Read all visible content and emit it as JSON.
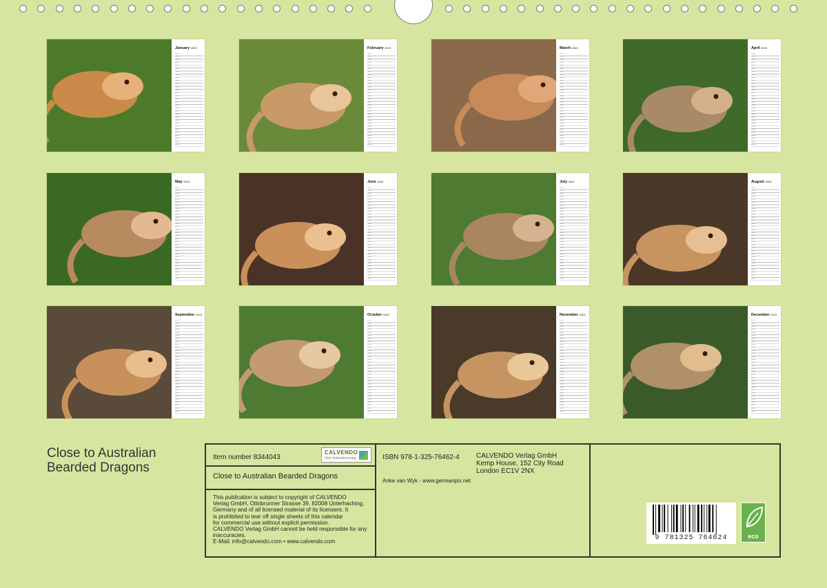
{
  "year": "2023",
  "months": [
    {
      "name": "January"
    },
    {
      "name": "February"
    },
    {
      "name": "March"
    },
    {
      "name": "April"
    },
    {
      "name": "May"
    },
    {
      "name": "June"
    },
    {
      "name": "July"
    },
    {
      "name": "August"
    },
    {
      "name": "September"
    },
    {
      "name": "October"
    },
    {
      "name": "November"
    },
    {
      "name": "December"
    }
  ],
  "title": "Close to Australian Bearded Dragons",
  "item_number": "Item number 8344043",
  "logo": {
    "brand": "CALVENDO",
    "tagline": "Dein Kalenderverlag"
  },
  "box_title": "Close to Australian Bearded Dragons",
  "legal_text": "This publication is subject to copyright of CALVENDO\nVerlag GmbH, Ottobrunner Strasse 39, 82008 Unterhaching,\nGermany and of all licensed material of its licensers. It\nis prohibited to tear off single sheets of this calendar\nfor commercial use without explicit permission.\nCALVENDO Verlag GmbH cannot be held responsible for any\ninaccuracies.\nE-Mail: info@calvendo.com • www.calvendo.com",
  "isbn": "ISBN 978-1-325-76462-4",
  "publisher": {
    "name": "CALVENDO Verlag GmbH",
    "address1": "Kemp House, 152 City Road",
    "address2": "London EC1V 2NX"
  },
  "author": "Anke van Wyk - www.germanpix.net",
  "barcode_number": "9 781325 764624",
  "eco_label": "eco",
  "colors": {
    "background": "#d6e6a0",
    "border": "#333333",
    "eco_green": "#6ab04c"
  }
}
